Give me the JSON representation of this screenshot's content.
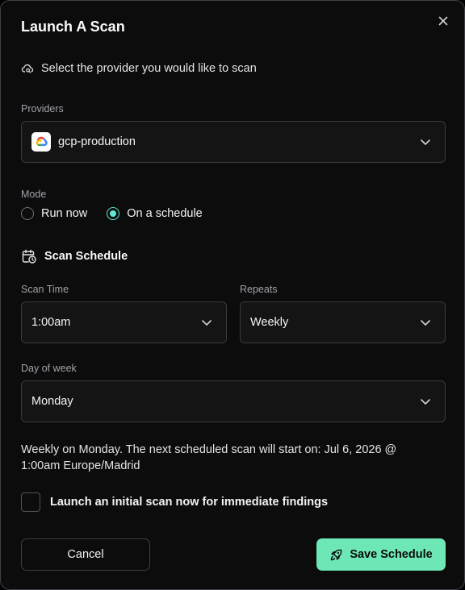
{
  "dialog": {
    "title": "Launch A Scan",
    "provider_hint": "Select the provider you would like to scan"
  },
  "providers": {
    "label": "Providers",
    "selected": "gcp-production",
    "selected_icon": "google-cloud-logo"
  },
  "mode": {
    "label": "Mode",
    "options": [
      {
        "label": "Run now",
        "checked": false
      },
      {
        "label": "On a schedule",
        "checked": true
      }
    ]
  },
  "schedule": {
    "heading": "Scan Schedule",
    "scan_time": {
      "label": "Scan Time",
      "value": "1:00am"
    },
    "repeats": {
      "label": "Repeats",
      "value": "Weekly"
    },
    "day_of_week": {
      "label": "Day of week",
      "value": "Monday"
    },
    "summary": "Weekly on Monday. The next scheduled scan will start on: Jul 6, 2026 @ 1:00am Europe/Madrid"
  },
  "initial_scan": {
    "label": "Launch an initial scan now for immediate findings",
    "checked": false
  },
  "actions": {
    "cancel_label": "Cancel",
    "save_label": "Save Schedule"
  },
  "colors": {
    "accent": "#6ee7b7",
    "radio_checked": "#5eead4",
    "background": "#0c0c0c"
  }
}
